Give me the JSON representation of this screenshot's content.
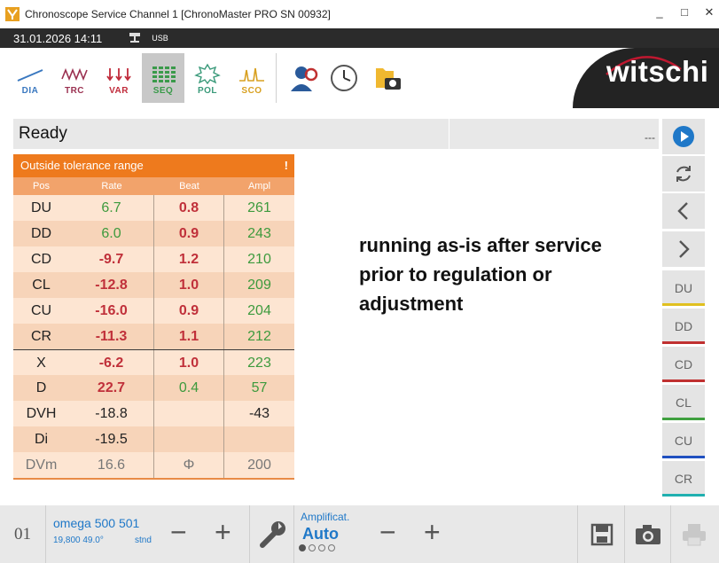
{
  "window": {
    "title": "Chronoscope Service Channel 1 [ChronoMaster PRO SN 00932]",
    "controls": [
      "_",
      "□",
      "✕"
    ]
  },
  "status": {
    "datetime": "31.01.2026  14:11",
    "connection": "USB"
  },
  "toolbar": {
    "tools": [
      {
        "label": "DIA",
        "color": "#3a78c0"
      },
      {
        "label": "TRC",
        "color": "#9a3050"
      },
      {
        "label": "VAR",
        "color": "#c02a3a"
      },
      {
        "label": "SEQ",
        "color": "#3a9a4a"
      },
      {
        "label": "POL",
        "color": "#3a9a7a"
      },
      {
        "label": "SCO",
        "color": "#d8a020"
      }
    ],
    "brand": "witschi"
  },
  "display": {
    "status_text": "Ready",
    "status_right": "---"
  },
  "results": {
    "header": "Outside tolerance range",
    "alert": "!",
    "columns": [
      "Pos",
      "Rate",
      "Beat",
      "Ampl"
    ],
    "rows": [
      {
        "pos": "DU",
        "rate": "6.7",
        "beat": "0.8",
        "ampl": "261"
      },
      {
        "pos": "DD",
        "rate": "6.0",
        "beat": "0.9",
        "ampl": "243"
      },
      {
        "pos": "CD",
        "rate": "-9.7",
        "beat": "1.2",
        "ampl": "210"
      },
      {
        "pos": "CL",
        "rate": "-12.8",
        "beat": "1.0",
        "ampl": "209"
      },
      {
        "pos": "CU",
        "rate": "-16.0",
        "beat": "0.9",
        "ampl": "204"
      },
      {
        "pos": "CR",
        "rate": "-11.3",
        "beat": "1.1",
        "ampl": "212"
      },
      {
        "pos": "X",
        "rate": "-6.2",
        "beat": "1.0",
        "ampl": "223"
      },
      {
        "pos": "D",
        "rate": "22.7",
        "beat": "0.4",
        "ampl": "57"
      },
      {
        "pos": "DVH",
        "rate": "-18.8",
        "beat": "",
        "ampl": "-43"
      },
      {
        "pos": "Di",
        "rate": "-19.5",
        "beat": "",
        "ampl": ""
      },
      {
        "pos": "DVm",
        "rate": "16.6",
        "beat": "Φ",
        "ampl": "200"
      }
    ]
  },
  "annotation": {
    "line1": "running as-is after service",
    "line2": "prior to regulation or",
    "line3": "adjustment"
  },
  "sidebar": {
    "positions": [
      {
        "label": "DU",
        "color": "#e0c020"
      },
      {
        "label": "DD",
        "color": "#c03030"
      },
      {
        "label": "CD",
        "color": "#c03030"
      },
      {
        "label": "CL",
        "color": "#40a040"
      },
      {
        "label": "CU",
        "color": "#2050c0"
      },
      {
        "label": "CR",
        "color": "#20b0b0"
      }
    ]
  },
  "bottom": {
    "index": "01",
    "caliber_name": "omega 500 501",
    "caliber_info": "19,800  49.0°",
    "caliber_std": "stnd",
    "ampl_label": "Amplificat.",
    "ampl_value": "Auto"
  },
  "colors": {
    "accent_orange": "#ee7a1d",
    "blue": "#1f78c8",
    "red": "#c0303a",
    "green": "#3d9a3d"
  }
}
